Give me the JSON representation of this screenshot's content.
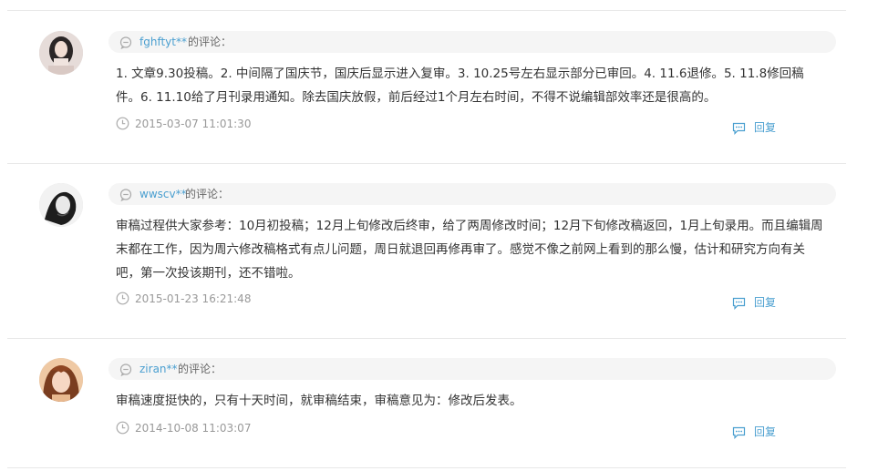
{
  "suffix_text": "的评论：",
  "reply_label": "回复",
  "comments": [
    {
      "user": "fghftyt**",
      "content": "1. 文章9.30投稿。2. 中间隔了国庆节，国庆后显示进入复审。3. 10.25号左右显示部分已审回。4. 11.6退修。5. 11.8修回稿件。6. 11.10给了月刊录用通知。除去国庆放假，前后经过1个月左右时间，不得不说编辑部效率还是很高的。",
      "time": "2015-03-07 11:01:30"
    },
    {
      "user": "wwscv**",
      "content": "审稿过程供大家参考：10月初投稿；12月上旬修改后终审，给了两周修改时间；12月下旬修改稿返回，1月上旬录用。而且编辑周末都在工作，因为周六修改稿格式有点儿问题，周日就退回再修再审了。感觉不像之前网上看到的那么慢，估计和研究方向有关吧，第一次投该期刊，还不错啦。",
      "time": "2015-01-23 16:21:48"
    },
    {
      "user": "ziran**",
      "content": "审稿速度挺快的，只有十天时间，就审稿结束，审稿意见为：修改后发表。",
      "time": "2014-10-08 11:03:07"
    }
  ],
  "colors": {
    "link": "#4a9fd0",
    "text": "#333333",
    "muted": "#999999",
    "header_bg": "#f5f5f5",
    "divider": "#e8e8e8"
  }
}
